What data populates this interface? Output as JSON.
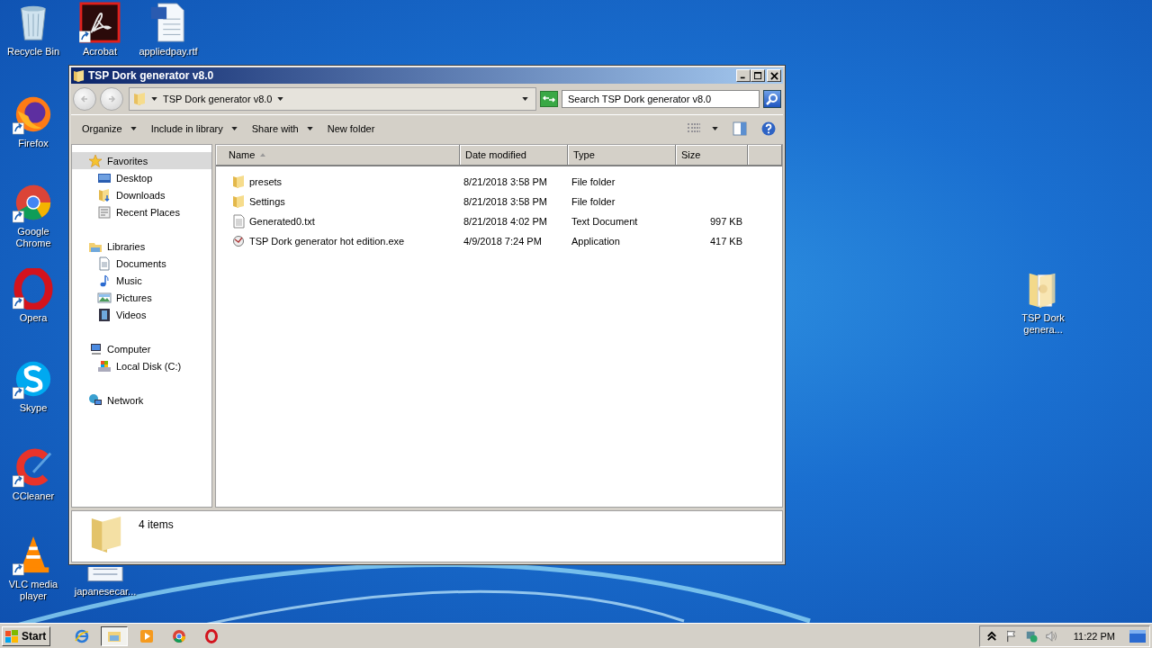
{
  "desktop_icons": [
    {
      "label": "Recycle Bin",
      "kind": "recycle",
      "shortcut": false
    },
    {
      "label": "Acrobat",
      "kind": "acrobat",
      "shortcut": true
    },
    {
      "label": "appliedpay.rtf",
      "kind": "word",
      "shortcut": false
    },
    {
      "label": "Firefox",
      "kind": "firefox",
      "shortcut": true
    },
    {
      "label": "Google Chrome",
      "kind": "chrome",
      "shortcut": true
    },
    {
      "label": "Opera",
      "kind": "opera",
      "shortcut": true
    },
    {
      "label": "Skype",
      "kind": "skype",
      "shortcut": true
    },
    {
      "label": "CCleaner",
      "kind": "ccleaner",
      "shortcut": true
    },
    {
      "label": "VLC media player",
      "kind": "vlc",
      "shortcut": true
    },
    {
      "label": "japanesecar...",
      "kind": "textdoc",
      "shortcut": false
    },
    {
      "label": "TSP Dork genera...",
      "kind": "folder",
      "shortcut": false
    }
  ],
  "window": {
    "title": "TSP Dork generator v8.0",
    "address": "TSP Dork generator v8.0",
    "search": {
      "placeholder": "Search TSP Dork generator v8.0"
    },
    "toolbar": [
      {
        "label": "Organize",
        "dropdown": true
      },
      {
        "label": "Include in library",
        "dropdown": true
      },
      {
        "label": "Share with",
        "dropdown": true
      },
      {
        "label": "New folder",
        "dropdown": false
      }
    ],
    "sidebar": [
      {
        "label": "Favorites",
        "kind": "star",
        "selected": true,
        "children": [
          {
            "label": "Desktop",
            "kind": "desktop",
            "selected": false
          },
          {
            "label": "Downloads",
            "kind": "downloads",
            "selected": false
          },
          {
            "label": "Recent Places",
            "kind": "recent",
            "selected": false
          }
        ]
      },
      {
        "label": "Libraries",
        "kind": "libraries",
        "selected": false,
        "children": [
          {
            "label": "Documents",
            "kind": "documents",
            "selected": false
          },
          {
            "label": "Music",
            "kind": "music",
            "selected": false
          },
          {
            "label": "Pictures",
            "kind": "pictures",
            "selected": false
          },
          {
            "label": "Videos",
            "kind": "videos",
            "selected": false
          }
        ]
      },
      {
        "label": "Computer",
        "kind": "computer",
        "selected": false,
        "children": [
          {
            "label": "Local Disk (C:)",
            "kind": "disk",
            "selected": false
          }
        ]
      },
      {
        "label": "Network",
        "kind": "network",
        "selected": false
      }
    ],
    "columns": [
      {
        "label": "Name",
        "sorted": true
      },
      {
        "label": "Date modified",
        "sorted": false
      },
      {
        "label": "Type",
        "sorted": false
      },
      {
        "label": "Size",
        "sorted": false
      }
    ],
    "files": [
      {
        "name": "presets",
        "date": "8/21/2018 3:58 PM",
        "type": "File folder",
        "kind": "folder"
      },
      {
        "name": "Settings",
        "date": "8/21/2018 3:58 PM",
        "type": "File folder",
        "kind": "folder"
      },
      {
        "name": "Generated0.txt",
        "date": "8/21/2018 4:02 PM",
        "type": "Text Document",
        "size": "997 KB",
        "kind": "text"
      },
      {
        "name": "TSP Dork generator hot edition.exe",
        "date": "4/9/2018 7:24 PM",
        "type": "Application",
        "size": "417 KB",
        "kind": "app"
      }
    ],
    "status": "4 items"
  },
  "taskbar": {
    "start": "Start",
    "apps": [
      {
        "kind": "ie",
        "selected": false
      },
      {
        "kind": "explorer",
        "selected": true
      },
      {
        "kind": "media",
        "selected": false
      },
      {
        "kind": "chrome",
        "selected": false
      },
      {
        "kind": "opera",
        "selected": false
      }
    ],
    "clock": "11:22 PM"
  }
}
